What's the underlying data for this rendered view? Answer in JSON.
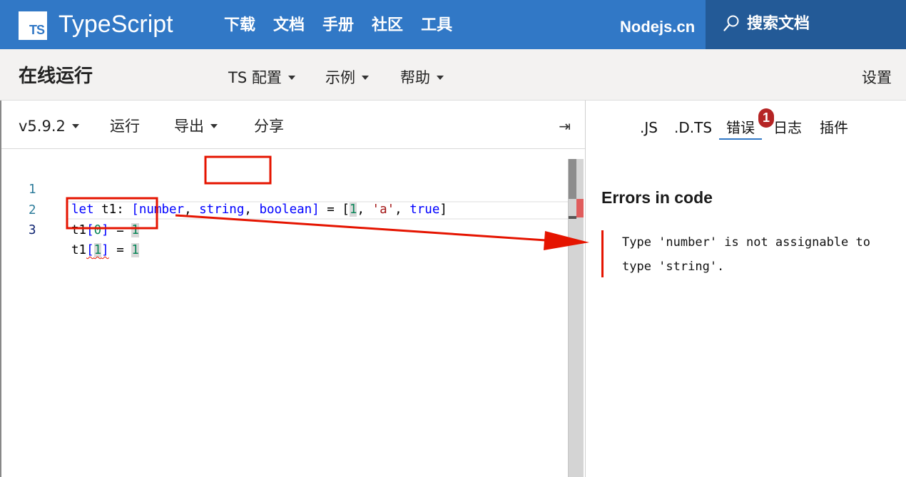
{
  "header": {
    "logo_text": "TS",
    "brand": "TypeScript",
    "nav": [
      "下载",
      "文档",
      "手册",
      "社区",
      "工具"
    ],
    "external_link": "Nodejs.cn",
    "search_label": "搜索文档",
    "colors": {
      "bar": "#3178c6",
      "search_bg": "#235a97"
    }
  },
  "playground_bar": {
    "title": "在线运行",
    "menus": [
      "TS 配置",
      "示例",
      "帮助"
    ],
    "settings": "设置"
  },
  "editor_toolbar": {
    "version": "v5.9.2",
    "run": "运行",
    "export": "导出",
    "share": "分享",
    "collapse_icon": "⇥"
  },
  "code": {
    "lines": [
      {
        "number": "1",
        "tokens": [
          {
            "t": "let",
            "c": "kw"
          },
          {
            "t": " t1: "
          },
          {
            "t": "[",
            "c": "kw"
          },
          {
            "t": "number",
            "c": "kw"
          },
          {
            "t": ", "
          },
          {
            "t": "string",
            "c": "kw"
          },
          {
            "t": ", "
          },
          {
            "t": "boolean",
            "c": "kw"
          },
          {
            "t": "]",
            "c": "kw"
          },
          {
            "t": " = ["
          },
          {
            "t": "1",
            "c": "num bracket-hl"
          },
          {
            "t": ", "
          },
          {
            "t": "'a'",
            "c": "str"
          },
          {
            "t": ", "
          },
          {
            "t": "true",
            "c": "kw"
          },
          {
            "t": "]"
          }
        ]
      },
      {
        "number": "2",
        "tokens": [
          {
            "t": "t1"
          },
          {
            "t": "[",
            "c": "kw"
          },
          {
            "t": "0",
            "c": "num"
          },
          {
            "t": "]",
            "c": "kw"
          },
          {
            "t": " = "
          },
          {
            "t": "1",
            "c": "num bracket-hl"
          }
        ]
      },
      {
        "number": "3",
        "tokens": [
          {
            "t": "t1"
          },
          {
            "t": "[",
            "c": "kw squiggle"
          },
          {
            "t": "1",
            "c": "num bracket-hl squiggle"
          },
          {
            "t": "]",
            "c": "kw squiggle"
          },
          {
            "t": " = "
          },
          {
            "t": "1",
            "c": "num bracket-hl"
          }
        ]
      }
    ],
    "active_line": "3",
    "scroll_position": 0
  },
  "sidebar": {
    "tabs": [
      ".JS",
      ".D.TS",
      "错误",
      "日志",
      "插件"
    ],
    "selected_tab": "错误",
    "error_count": "1",
    "heading": "Errors in code",
    "errors": [
      "Type 'number' is not assignable to type 'string'."
    ]
  },
  "annotation": {
    "color": "#e51400",
    "type": "highlight-boxes-with-arrow"
  }
}
